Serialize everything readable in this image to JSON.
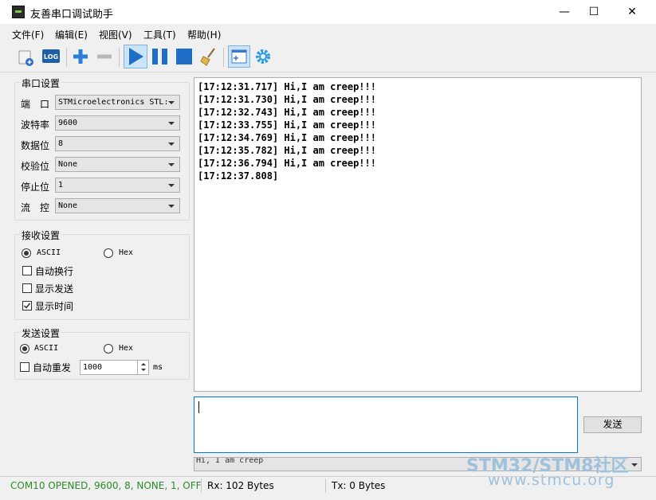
{
  "window": {
    "title": "友善串口调试助手",
    "minimize": "—",
    "maximize": "☐",
    "close": "✕"
  },
  "menu": [
    "文件(F)",
    "编辑(E)",
    "视图(V)",
    "工具(T)",
    "帮助(H)"
  ],
  "toolbar": {
    "log_label": "LOG"
  },
  "serial_settings": {
    "title": "串口设置",
    "port": {
      "label": "端　口",
      "value": "STMicroelectronics STL:"
    },
    "baud": {
      "label": "波特率",
      "value": "9600"
    },
    "databits": {
      "label": "数据位",
      "value": "8"
    },
    "parity": {
      "label": "校验位",
      "value": "None"
    },
    "stopbits": {
      "label": "停止位",
      "value": "1"
    },
    "flow": {
      "label": "流　控",
      "value": "None"
    }
  },
  "receive_settings": {
    "title": "接收设置",
    "ascii": "ASCII",
    "hex": "Hex",
    "mode": "ASCII",
    "auto_newline": {
      "label": "自动换行",
      "checked": false
    },
    "show_send": {
      "label": "显示发送",
      "checked": false
    },
    "show_time": {
      "label": "显示时间",
      "checked": true
    }
  },
  "send_settings": {
    "title": "发送设置",
    "ascii": "ASCII",
    "hex": "Hex",
    "mode": "ASCII",
    "auto_resend": {
      "label": "自动重发",
      "checked": false
    },
    "interval": "1000",
    "unit": "ms"
  },
  "receive_lines": [
    "[17:12:31.717] Hi,I am creep!!!",
    "[17:12:31.730] Hi,I am creep!!!",
    "[17:12:32.743] Hi,I am creep!!!",
    "[17:12:33.755] Hi,I am creep!!!",
    "[17:12:34.769] Hi,I am creep!!!",
    "[17:12:35.782] Hi,I am creep!!!",
    "[17:12:36.794] Hi,I am creep!!!",
    "[17:12:37.808]"
  ],
  "send_input": "",
  "send_button": "发送",
  "history_value": "Hi, I am creep",
  "status": {
    "port": "COM10 OPENED, 9600, 8, NONE, 1, OFF",
    "rx": "Rx: 102 Bytes",
    "tx": "Tx: 0 Bytes"
  },
  "watermark": {
    "line1": "STM32/STM8社区",
    "line2": "www.stmcu.org"
  },
  "colors": {
    "status_ok": "#2a8a2a",
    "accent": "#0078d7",
    "watermark": "#9ec1dc"
  }
}
